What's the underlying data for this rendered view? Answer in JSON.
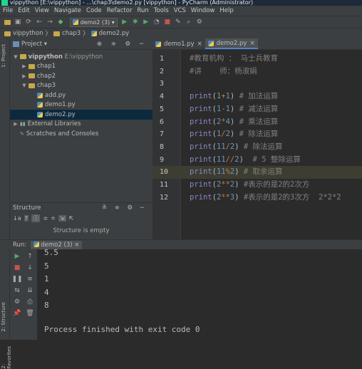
{
  "window": {
    "title": "vippython [E:\\vippython] - ...\\chap3\\demo2.py [vippython] - PyCharm (Administrator)"
  },
  "menu": [
    "File",
    "Edit",
    "View",
    "Navigate",
    "Code",
    "Refactor",
    "Run",
    "Tools",
    "VCS",
    "Window",
    "Help"
  ],
  "toolbar": {
    "run_config": "demo2 (3)"
  },
  "breadcrumb": [
    "vippython",
    "chap3",
    "demo2.py"
  ],
  "project": {
    "title": "Project",
    "root": "vippython",
    "root_path": "E:\\vippython",
    "items": [
      {
        "label": "chap1",
        "depth": 1,
        "type": "folder",
        "expanded": false
      },
      {
        "label": "chap2",
        "depth": 1,
        "type": "folder",
        "expanded": false
      },
      {
        "label": "chap3",
        "depth": 1,
        "type": "folder",
        "expanded": true
      },
      {
        "label": "add.py",
        "depth": 2,
        "type": "file"
      },
      {
        "label": "demo1.py",
        "depth": 2,
        "type": "file"
      },
      {
        "label": "demo2.py",
        "depth": 2,
        "type": "file",
        "selected": true
      }
    ],
    "external": "External Libraries",
    "scratches": "Scratches and Consoles"
  },
  "structure": {
    "title": "Structure",
    "empty": "Structure is empty"
  },
  "editor": {
    "tabs": [
      {
        "label": "demo1.py",
        "active": false
      },
      {
        "label": "demo2.py",
        "active": true
      }
    ],
    "lines": [
      {
        "n": "1",
        "tokens": [
          [
            "cm",
            "#教育机构 ： 马士兵教育"
          ]
        ]
      },
      {
        "n": "2",
        "tokens": [
          [
            "cm",
            "#讲    师：杨淑娟"
          ]
        ]
      },
      {
        "n": "3",
        "tokens": []
      },
      {
        "n": "4",
        "tokens": [
          [
            "fn",
            "print"
          ],
          [
            "pl",
            "("
          ],
          [
            "num",
            "1"
          ],
          [
            "op",
            "+"
          ],
          [
            "num",
            "1"
          ],
          [
            "pl",
            ")"
          ],
          [
            "cm",
            " # 加法运算"
          ]
        ]
      },
      {
        "n": "5",
        "tokens": [
          [
            "fn",
            "print"
          ],
          [
            "pl",
            "("
          ],
          [
            "num",
            "1"
          ],
          [
            "op",
            "-"
          ],
          [
            "num",
            "1"
          ],
          [
            "pl",
            ")"
          ],
          [
            "cm",
            " # 减法运算"
          ]
        ]
      },
      {
        "n": "6",
        "tokens": [
          [
            "fn",
            "print"
          ],
          [
            "pl",
            "("
          ],
          [
            "num",
            "2"
          ],
          [
            "op",
            "*"
          ],
          [
            "num",
            "4"
          ],
          [
            "pl",
            ")"
          ],
          [
            "cm",
            " # 乘法运算"
          ]
        ]
      },
      {
        "n": "7",
        "tokens": [
          [
            "fn",
            "print"
          ],
          [
            "pl",
            "("
          ],
          [
            "num",
            "1"
          ],
          [
            "op",
            "/"
          ],
          [
            "num",
            "2"
          ],
          [
            "pl",
            ")"
          ],
          [
            "cm",
            " # 除法运算"
          ]
        ]
      },
      {
        "n": "8",
        "tokens": [
          [
            "fn",
            "print"
          ],
          [
            "pl",
            "("
          ],
          [
            "num",
            "11"
          ],
          [
            "op",
            "/"
          ],
          [
            "num",
            "2"
          ],
          [
            "pl",
            ")"
          ],
          [
            "cm",
            " # 除法运算"
          ]
        ]
      },
      {
        "n": "9",
        "tokens": [
          [
            "fn",
            "print"
          ],
          [
            "pl",
            "("
          ],
          [
            "num",
            "11"
          ],
          [
            "op",
            "//"
          ],
          [
            "num",
            "2"
          ],
          [
            "pl",
            ")"
          ],
          [
            "cm",
            "  # 5 整除运算"
          ]
        ]
      },
      {
        "n": "10",
        "tokens": [
          [
            "fn",
            "print"
          ],
          [
            "pl",
            "("
          ],
          [
            "num",
            "11"
          ],
          [
            "op",
            "%"
          ],
          [
            "num",
            "2"
          ],
          [
            "pl",
            ")"
          ],
          [
            "cm",
            " # 取余运算"
          ]
        ],
        "highlight": true
      },
      {
        "n": "11",
        "tokens": [
          [
            "fn",
            "print"
          ],
          [
            "pl",
            "("
          ],
          [
            "num",
            "2"
          ],
          [
            "op",
            "**"
          ],
          [
            "num",
            "2"
          ],
          [
            "pl",
            ")"
          ],
          [
            "cm",
            " #表示的是2的2次方"
          ]
        ]
      },
      {
        "n": "12",
        "tokens": [
          [
            "fn",
            "print"
          ],
          [
            "pl",
            "("
          ],
          [
            "num",
            "2"
          ],
          [
            "op",
            "**"
          ],
          [
            "num",
            "3"
          ],
          [
            "pl",
            ")"
          ],
          [
            "cm",
            " #表示的是2的3次方  2*2*2"
          ]
        ]
      }
    ]
  },
  "run": {
    "label": "Run:",
    "tab": "demo2 (3)",
    "output": [
      "5.5",
      "5",
      "1",
      "4",
      "8"
    ],
    "exit": "Process finished with exit code 0"
  },
  "sidetabs": {
    "project": "1: Project",
    "structure": "2: Structure",
    "favorites": "2: Favorites"
  }
}
